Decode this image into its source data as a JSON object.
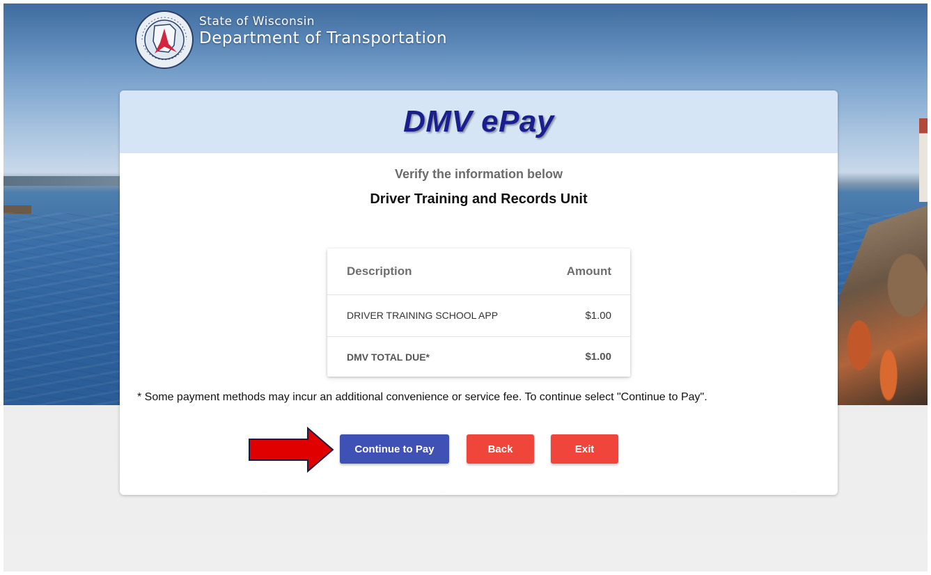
{
  "header": {
    "state_line": "State of Wisconsin",
    "dept_line": "Department of Transportation",
    "seal_icon": "wisconsin-dot-seal-icon"
  },
  "card": {
    "title": "DMV ePay",
    "verify_text": "Verify the information below",
    "unit_name": "Driver Training and Records Unit"
  },
  "fees": {
    "headers": {
      "description": "Description",
      "amount": "Amount"
    },
    "items": [
      {
        "description": "DRIVER TRAINING SCHOOL APP",
        "amount": "$1.00"
      }
    ],
    "total": {
      "label": "DMV TOTAL DUE*",
      "amount": "$1.00"
    }
  },
  "note": "* Some payment methods may incur an additional convenience or service fee. To continue select \"Continue to Pay\".",
  "buttons": {
    "continue": "Continue to Pay",
    "back": "Back",
    "exit": "Exit"
  },
  "colors": {
    "primary": "#3f51b5",
    "danger": "#f0453a",
    "title": "#1a1f8f",
    "header_band": "#d6e5f5",
    "annotation_arrow": "#e00000"
  }
}
